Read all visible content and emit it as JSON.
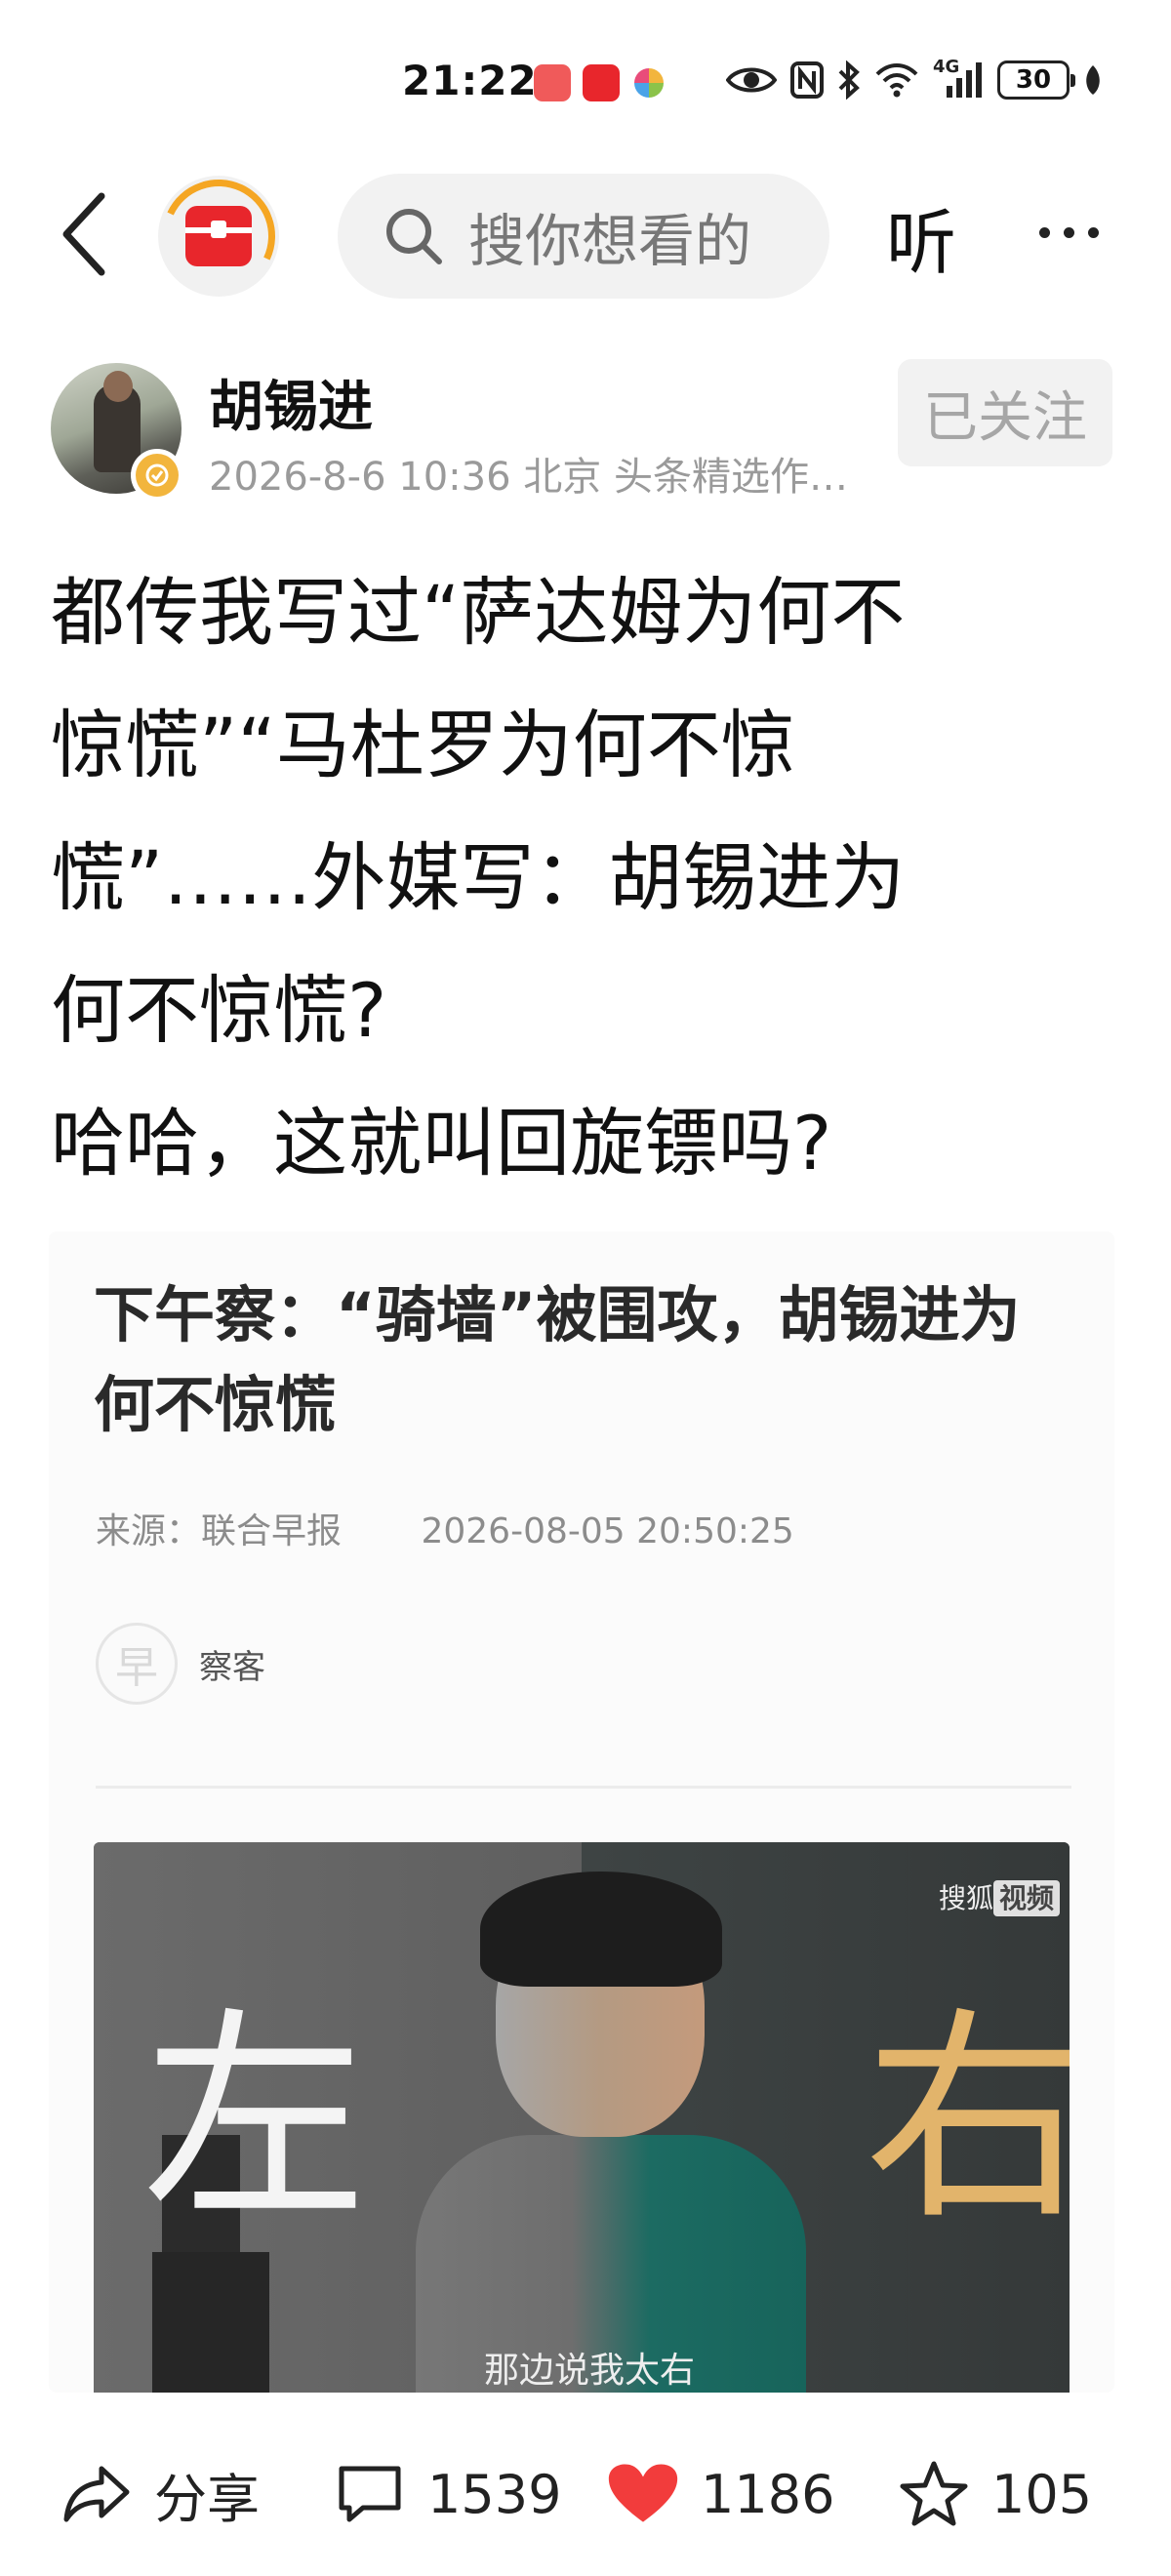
{
  "status_bar": {
    "time": "21:22",
    "network": "4G",
    "battery": "30",
    "accent_colors": [
      "#f05a5a",
      "#e8262c",
      "#8bc34a"
    ]
  },
  "nav": {
    "search_placeholder": "搜你想看的",
    "listen_label": "听"
  },
  "author": {
    "name": "胡锡进",
    "meta": "2026-8-6 10:36 北京 头条精选作…",
    "follow_label": "已关注"
  },
  "headline": {
    "lines": [
      "都传我写过“萨达姆为何不",
      "惊慌”“马杜罗为何不惊",
      "慌”……外媒写：胡锡进为",
      "何不惊慌?",
      "哈哈，这就叫回旋镖吗?"
    ]
  },
  "article_card": {
    "title": "下午察：“骑墙”被围攻，胡锡进为何不惊慌",
    "source": "来源：联合早报",
    "date": "2026-08-05 20:50:25",
    "source_logo_char": "早",
    "source_name": "察客",
    "image": {
      "left_char": "左",
      "right_char": "右",
      "watermark_prefix": "搜狐",
      "watermark_tag": "视频",
      "caption": "那边说我太右"
    }
  },
  "bottom_bar": {
    "share_label": "分享",
    "comment_count": "1539",
    "like_count": "1186",
    "favorite_count": "105",
    "like_color": "#f23c3c"
  }
}
